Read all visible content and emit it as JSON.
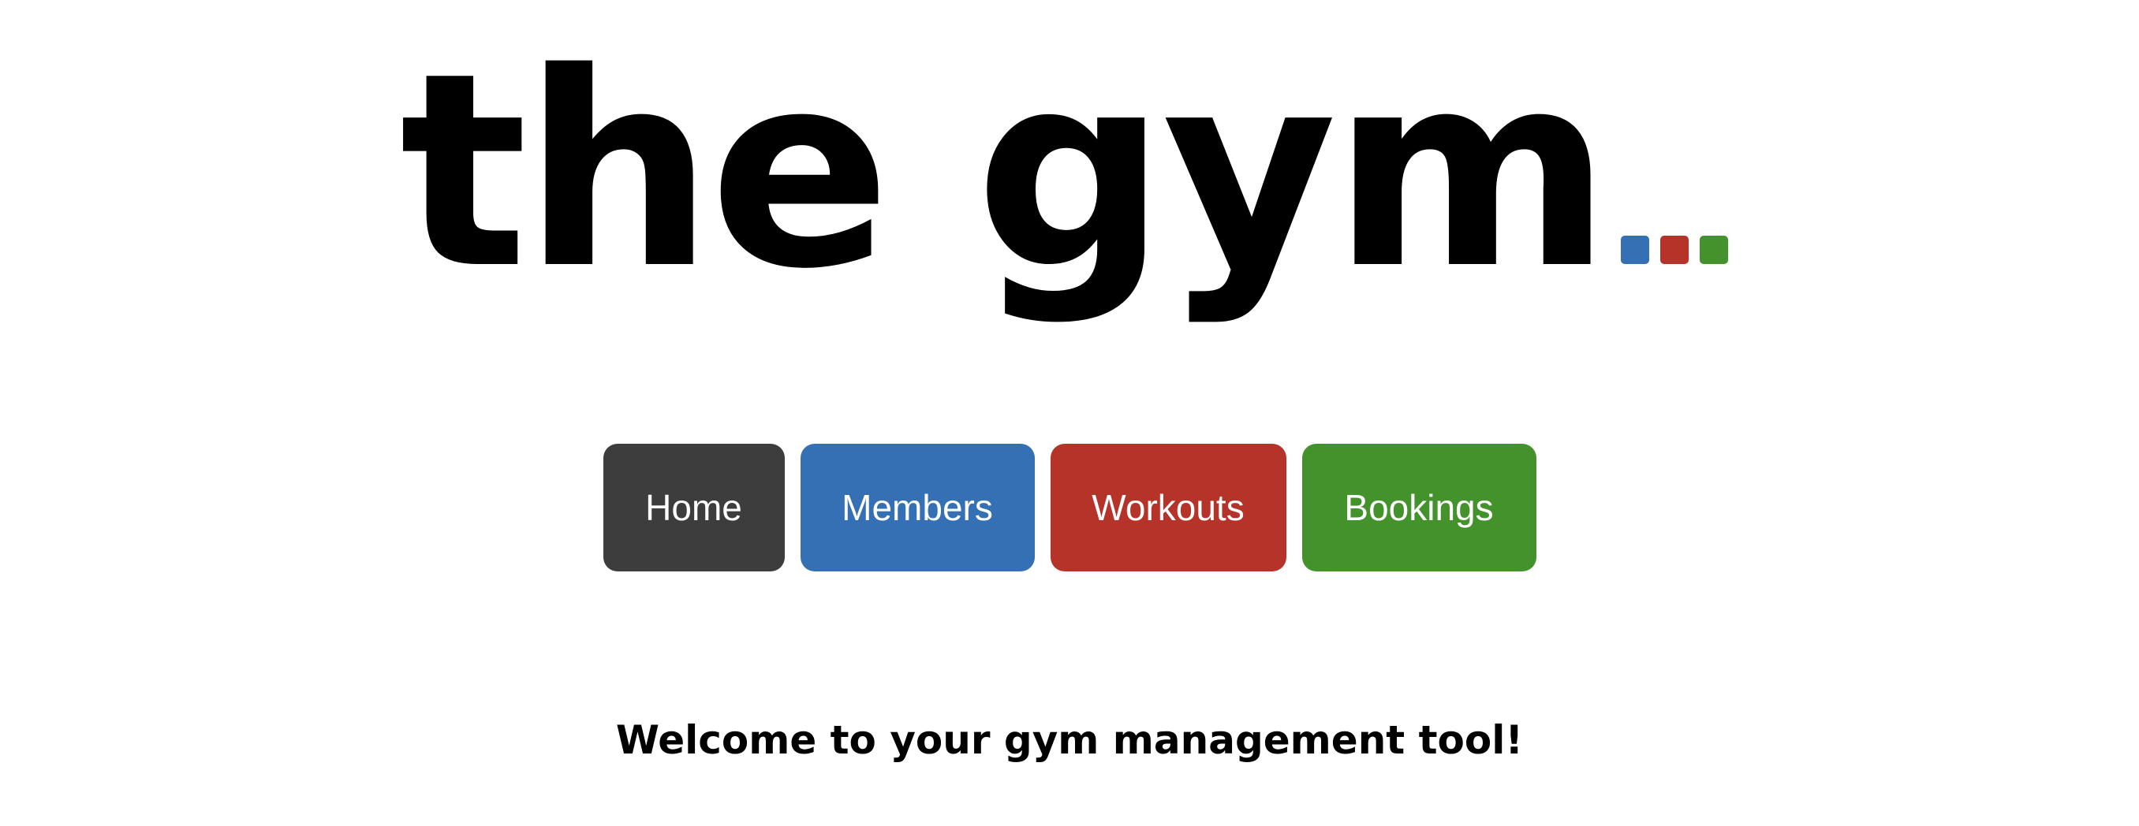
{
  "logo": {
    "text": "the gym",
    "dot_colors": [
      "#3570b5",
      "#b53328",
      "#43922b"
    ]
  },
  "nav": {
    "items": [
      {
        "label": "Home",
        "color": "#3d3d3d"
      },
      {
        "label": "Members",
        "color": "#3570b5"
      },
      {
        "label": "Workouts",
        "color": "#b53328"
      },
      {
        "label": "Bookings",
        "color": "#43922b"
      }
    ]
  },
  "welcome": {
    "text": "Welcome to your gym management tool!"
  }
}
